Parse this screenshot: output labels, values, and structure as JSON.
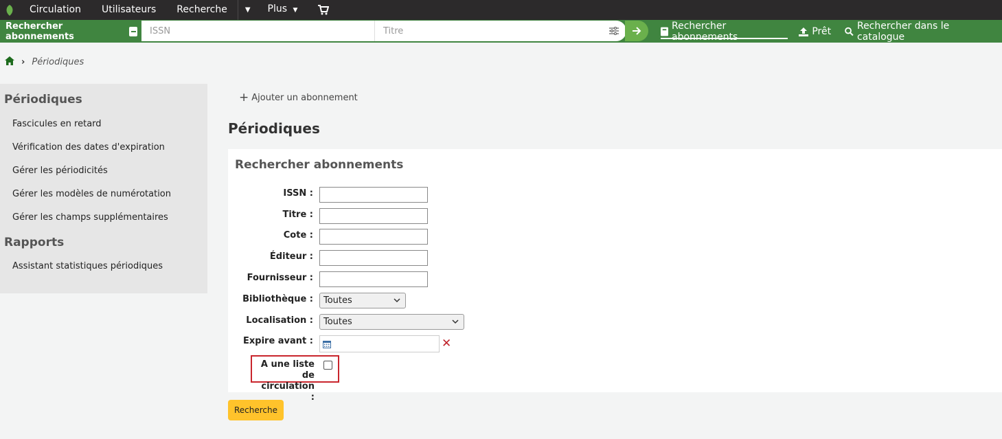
{
  "topnav": {
    "items": [
      "Circulation",
      "Utilisateurs",
      "Recherche"
    ],
    "more_label": "Plus"
  },
  "searchbar": {
    "title": "Rechercher abonnements",
    "issn_placeholder": "ISSN",
    "title_placeholder": "Titre",
    "links": [
      "Rechercher abonnements",
      "Prêt",
      "Rechercher dans le catalogue"
    ]
  },
  "breadcrumb": {
    "current": "Périodiques"
  },
  "sidebar": {
    "section1_title": "Périodiques",
    "section1_items": [
      "Fascicules en retard",
      "Vérification des dates d'expiration",
      "Gérer les périodicités",
      "Gérer les modèles de numérotation",
      "Gérer les champs supplémentaires"
    ],
    "section2_title": "Rapports",
    "section2_items": [
      "Assistant statistiques périodiques"
    ]
  },
  "main": {
    "add_link": "Ajouter un abonnement",
    "page_title": "Périodiques",
    "panel_title": "Rechercher abonnements",
    "form": {
      "issn_label": "ISSN :",
      "titre_label": "Titre :",
      "cote_label": "Cote :",
      "editeur_label": "Éditeur :",
      "fournisseur_label": "Fournisseur :",
      "bibliotheque_label": "Bibliothèque :",
      "bibliotheque_value": "Toutes",
      "localisation_label": "Localisation :",
      "localisation_value": "Toutes",
      "expire_label": "Expire avant :",
      "circulation_label": "A une liste de circulation :"
    },
    "submit_label": "Recherche"
  },
  "colors": {
    "topbar": "#2c2a2b",
    "header_green": "#408540",
    "go_button": "#6ab04c",
    "submit_yellow": "#ffc32b",
    "highlight_red": "#c9252c"
  }
}
